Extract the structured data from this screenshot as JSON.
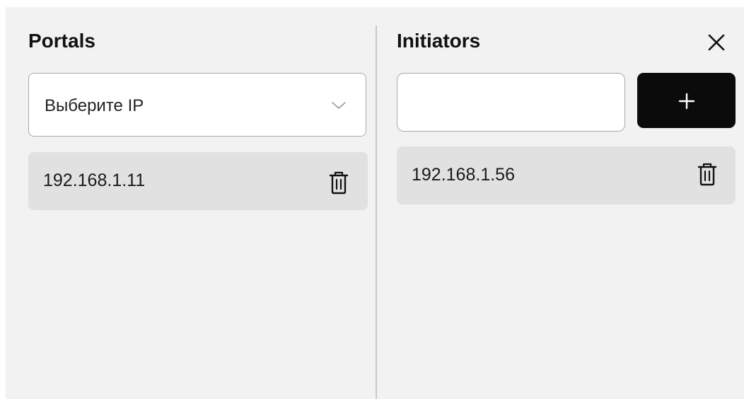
{
  "portals": {
    "title": "Portals",
    "select_placeholder": "Выберите IP",
    "items": [
      {
        "ip": "192.168.1.11",
        "delete_icon": "trash-icon"
      }
    ]
  },
  "initiators": {
    "title": "Initiators",
    "input_value": "",
    "add_icon": "plus-icon",
    "items": [
      {
        "ip": "192.168.1.56",
        "delete_icon": "trash-icon"
      }
    ]
  },
  "close_icon": "close-icon",
  "colors": {
    "background": "#f2f2f2",
    "item_background": "#e1e1e1",
    "add_button": "#0b0b0b",
    "divider": "#c9c9c9"
  }
}
